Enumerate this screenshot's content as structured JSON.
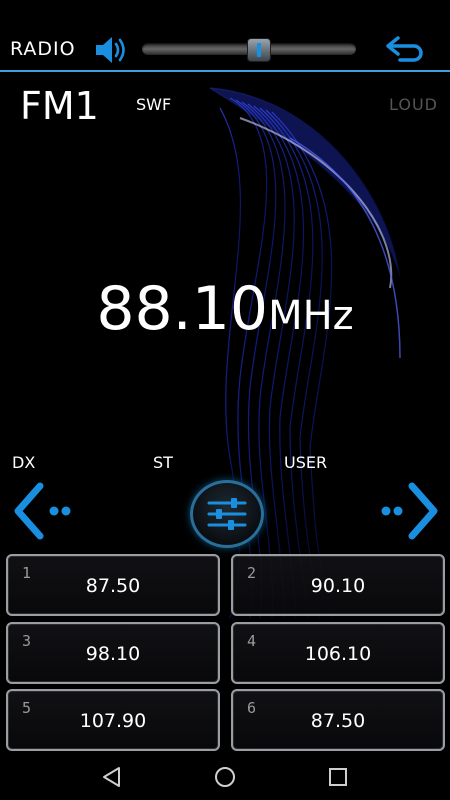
{
  "header": {
    "title": "RADIO",
    "volume_level": 0.54
  },
  "band": "FM1",
  "swf": "SWF",
  "loud": "LOUD",
  "frequency": {
    "value": "88.10",
    "unit": "MHz"
  },
  "indicators": {
    "dx": "DX",
    "st": "ST",
    "user": "USER"
  },
  "presets": [
    {
      "num": "1",
      "freq": "87.50"
    },
    {
      "num": "2",
      "freq": "90.10"
    },
    {
      "num": "3",
      "freq": "98.10"
    },
    {
      "num": "4",
      "freq": "106.10"
    },
    {
      "num": "5",
      "freq": "107.90"
    },
    {
      "num": "6",
      "freq": "87.50"
    }
  ],
  "colors": {
    "accent": "#1a8fe0",
    "divider": "#3aa0df",
    "wave": "#2a3bd6"
  },
  "icons": {
    "volume": "volume-icon",
    "back": "back-arrow-icon",
    "seek_left": "seek-left-icon",
    "seek_right": "seek-right-icon",
    "equalizer": "equalizer-icon",
    "nav_back": "nav-back-icon",
    "nav_home": "nav-home-icon",
    "nav_recents": "nav-recents-icon"
  }
}
